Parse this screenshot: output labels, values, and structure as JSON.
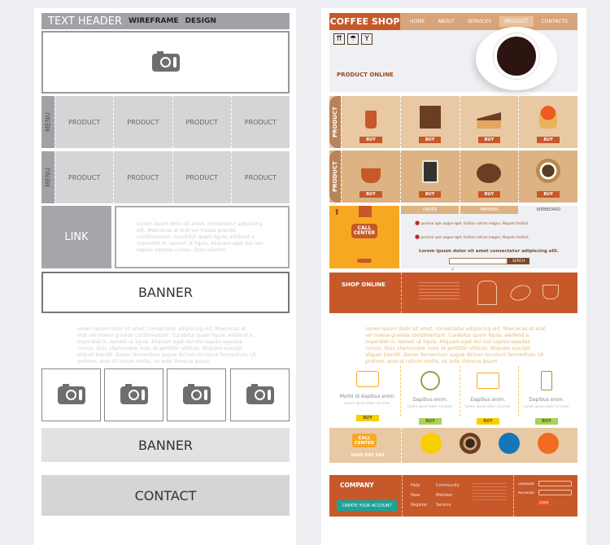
{
  "wireframe": {
    "header": {
      "title": "TEXT HEADER",
      "sub1": "WIREFRAME",
      "sub2": "DESIGN"
    },
    "hero_icon": "camera-icon",
    "rows": [
      {
        "menu": "MENU",
        "products": [
          "PRODUCT",
          "PRODUCT",
          "PRODUCT",
          "PRODUCT"
        ]
      },
      {
        "menu": "MENU",
        "products": [
          "PRODUCT",
          "PRODUCT",
          "PRODUCT",
          "PRODUCT"
        ]
      }
    ],
    "link": "LINK",
    "link_text": "Lorem ipsum dolor sit amet, consectetur adipiscing elit. Maecenas at erat vel massa gravida condimentum. Curabitur quam ligula, eleifend a imperdiet in, laoreet ut ligula. Aliquam eget dui non sapien egestas cursus. Duis ullamco",
    "banner": "BANNER",
    "body_text": "Lorem ipsum dolor sit amet, consectetur adipiscing elit. Maecenas at erat vel massa gravida condimentum. Curabitur quam ligula, eleifend a imperdiet in, laoreet ut ligula. Aliquam eget dui non sapien egestas cursus. Duis ullamcorper nunc et porttitor ultrices. Aliquam suscipit aliquet blandit. Donec fermentum augue dictum tincidunt fermentum. Ut pretium, eros et rutrum mollis, ex ante rhoncus ipsum",
    "banner2": "BANNER",
    "contact": "CONTACT"
  },
  "coffee": {
    "logo": "COFFEE SHOP",
    "nav": [
      "HOME",
      "ABOUT",
      "SERVICES",
      "PRODUCT",
      "CONTACTS"
    ],
    "active_nav": "PRODUCT",
    "hero_title": "PRODUCT ONLINE",
    "rows": [
      {
        "label": "PRODUCT",
        "items": [
          "takeaway-cup-icon",
          "coffee-machine-icon",
          "cake-slice-icon",
          "cupcake-icon"
        ],
        "buy": "BUY"
      },
      {
        "label": "PRODUCT",
        "items": [
          "hot-cup-icon",
          "menu-board-icon",
          "coffee-beans-icon",
          "coffee-cup-top-icon"
        ],
        "buy": "BUY"
      }
    ],
    "call_center": "CALL CENTER",
    "tabs": [
      "ORDER",
      "MEMBER",
      "WEBBOARD"
    ],
    "tab_items": [
      "pulvinar quis augue eget, facilisis rutrum magna. Aliquam facilisis.",
      "pulvinar quis augue eget, facilisis rutrum magna. Aliquam facilisis."
    ],
    "tagline": "Lorem ipsum dolor sit amet consectetur adipiscing elit.",
    "search_button": "SERCH",
    "shop_online": "SHOP ONLINE",
    "body_text": "Lorem ipsum dolor sit amet, consectetur adipiscing elit. Maecenas at erat vel massa gravida condimentum. Curabitur quam ligula, eleifend a imperdiet in, laoreet ut ligula. Aliquam eget dui non sapien egestas cursus. Duis ullamcorper nunc et porttitor ultrices. Aliquam suscipit aliquet blandit. Donec fermentum augue dictum tincidunt fermentum. Ut pretium, eros et rutrum mollis, ex ante rhoncus ipsum",
    "features": [
      {
        "title": "Morbi id dapibus enim.",
        "sub": "Lorem ipsum dolor sit amet.",
        "buy": "BUY"
      },
      {
        "title": "Dapibus enim.",
        "sub": "Lorem ipsum dolor sit amet.",
        "buy": "BUY"
      },
      {
        "title": "Dapibus enim.",
        "sub": "Lorem ipsum dolor sit amet.",
        "buy": "BUY"
      },
      {
        "title": "Dapibus enim.",
        "sub": "Lorem ipsum dolor sit amet.",
        "buy": "BUY"
      }
    ],
    "call_center2": "CALL CENTER",
    "phone": "1605 032 542",
    "footer": {
      "company": "COMPANY",
      "create": "CREATE YOUR ACCOUNT",
      "links1": [
        "Help",
        "New",
        "Register"
      ],
      "links2": [
        "Community",
        "Member",
        "Service"
      ],
      "username": "USERNAME",
      "password": "PASSWORD",
      "login": "LOGIN"
    },
    "colors": {
      "brand": "#c6582a",
      "tan": "#e8c9a4",
      "orange": "#f7a823",
      "teal": "#1aa39b"
    }
  }
}
